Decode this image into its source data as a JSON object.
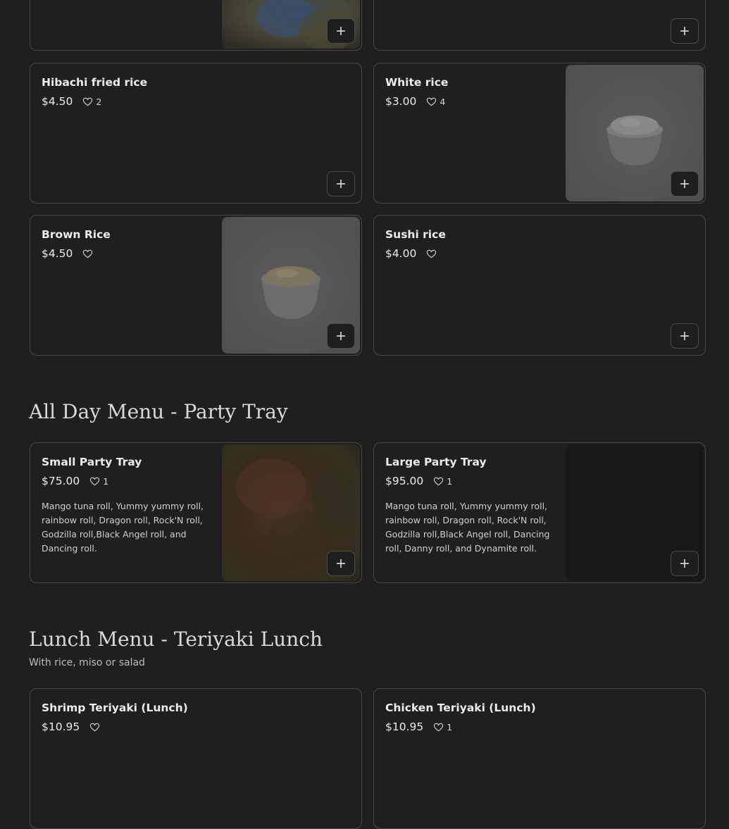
{
  "colors": {
    "background": "#1f1f21",
    "card_border": "#474749",
    "text": "#ececec"
  },
  "icons": {
    "like": "heart-outline-icon",
    "add": "plus-icon"
  },
  "rice_items": [
    {
      "name": "",
      "price": "",
      "likes": "",
      "has_photo": true
    },
    {
      "name": "",
      "price": "",
      "likes": "",
      "has_photo": false
    },
    {
      "name": "Hibachi fried rice",
      "price": "$4.50",
      "likes": "2",
      "has_photo": false
    },
    {
      "name": "White rice",
      "price": "$3.00",
      "likes": "4",
      "has_photo": true
    },
    {
      "name": "Brown Rice",
      "price": "$4.50",
      "likes": "",
      "has_photo": true
    },
    {
      "name": "Sushi rice",
      "price": "$4.00",
      "likes": "",
      "has_photo": false
    }
  ],
  "party_tray": {
    "title": "All Day Menu - Party Tray",
    "items": [
      {
        "name": "Small Party Tray",
        "price": "$75.00",
        "likes": "1",
        "description": "Mango tuna roll, Yummy yummy roll, rainbow roll, Dragon roll, Rock'N roll, Godzilla roll,Black Angel roll, and Dancing roll.",
        "has_photo": true
      },
      {
        "name": "Large Party Tray",
        "price": "$95.00",
        "likes": "1",
        "description": "Mango tuna roll, Yummy yummy roll, rainbow roll, Dragon roll, Rock'N roll, Godzilla roll,Black Angel roll, Dancing roll, Danny roll, and Dynamite roll.",
        "has_photo": true
      }
    ]
  },
  "teriyaki_lunch": {
    "title": "Lunch Menu - Teriyaki Lunch",
    "subtitle": "With rice, miso or salad",
    "items": [
      {
        "name": "Shrimp Teriyaki (Lunch)",
        "price": "$10.95",
        "likes": ""
      },
      {
        "name": "Chicken Teriyaki (Lunch)",
        "price": "$10.95",
        "likes": "1"
      }
    ]
  }
}
